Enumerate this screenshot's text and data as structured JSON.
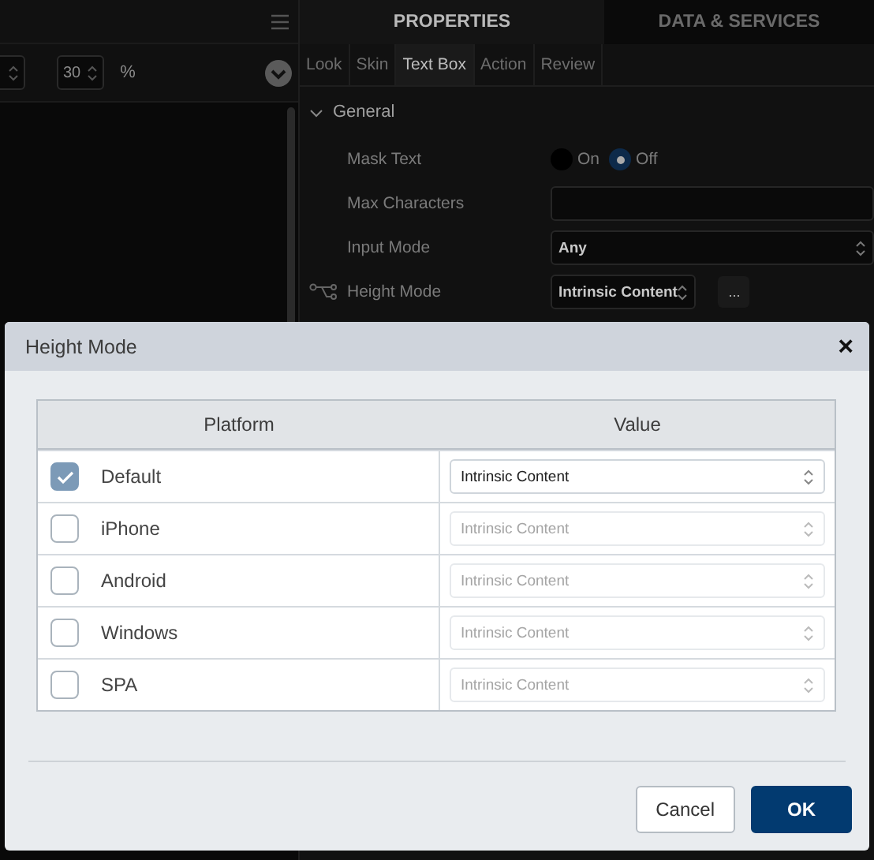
{
  "canvas_toolbar": {
    "zoom_value": "30",
    "zoom_unit": "%"
  },
  "panel_tabs": [
    {
      "label": "PROPERTIES",
      "selected": true
    },
    {
      "label": "DATA & SERVICES",
      "selected": false
    }
  ],
  "sub_tabs": [
    {
      "label": "Look",
      "selected": false
    },
    {
      "label": "Skin",
      "selected": false
    },
    {
      "label": "Text Box",
      "selected": true
    },
    {
      "label": "Action",
      "selected": false
    },
    {
      "label": "Review",
      "selected": false
    }
  ],
  "section": {
    "title": "General",
    "expanded": true
  },
  "properties": [
    {
      "kind": "radio",
      "label": "Mask Text",
      "options": [
        {
          "label": "On",
          "selected": false
        },
        {
          "label": "Off",
          "selected": true
        }
      ]
    },
    {
      "kind": "text",
      "label": "Max Characters"
    },
    {
      "kind": "select",
      "label": "Input Mode",
      "value": "Any"
    },
    {
      "kind": "platform-select",
      "label": "Height Mode",
      "value": "Intrinsic Content",
      "more": "..."
    }
  ],
  "dialog": {
    "title": "Height Mode",
    "close": "×",
    "columns": [
      "Platform",
      "Value"
    ],
    "rows": [
      {
        "platform": "Default",
        "checked": true,
        "value": "Intrinsic Content"
      },
      {
        "platform": "iPhone",
        "checked": false,
        "value": "Intrinsic Content"
      },
      {
        "platform": "Android",
        "checked": false,
        "value": "Intrinsic Content"
      },
      {
        "platform": "Windows",
        "checked": false,
        "value": "Intrinsic Content"
      },
      {
        "platform": "SPA",
        "checked": false,
        "value": "Intrinsic Content"
      }
    ],
    "buttons": [
      {
        "label": "Cancel",
        "kind": "secondary"
      },
      {
        "label": "OK",
        "kind": "primary"
      }
    ]
  }
}
